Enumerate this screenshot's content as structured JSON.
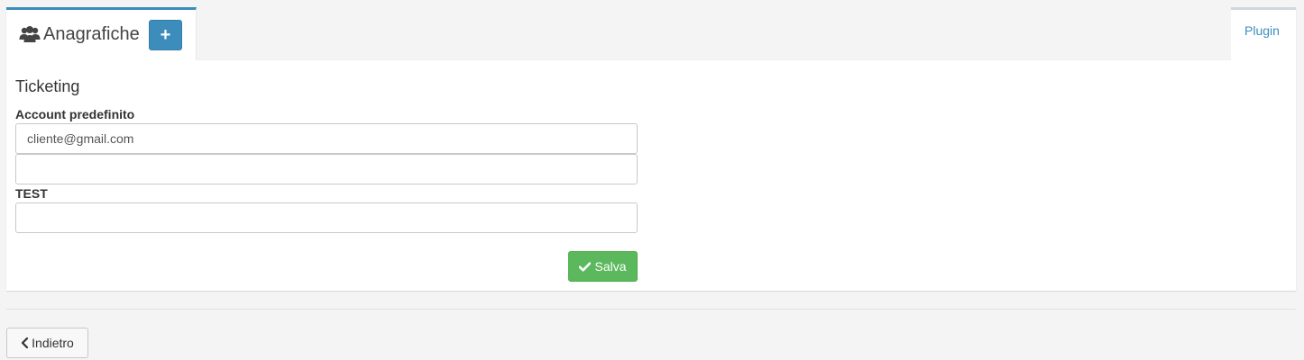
{
  "tabs": {
    "main": {
      "title": "Anagrafiche",
      "icon": "users-icon",
      "add_label": "+"
    },
    "plugin": {
      "label": "Plugin"
    }
  },
  "form": {
    "section_title": "Ticketing",
    "account": {
      "label": "Account predefinito",
      "value": "cliente@gmail.com"
    },
    "second": {
      "value": ""
    },
    "test": {
      "label": "TEST",
      "value": ""
    },
    "save_label": "Salva"
  },
  "footer": {
    "back_label": "Indietro"
  },
  "colors": {
    "primary": "#3c8dbc",
    "success": "#5cb85c",
    "background": "#f4f4f4"
  }
}
